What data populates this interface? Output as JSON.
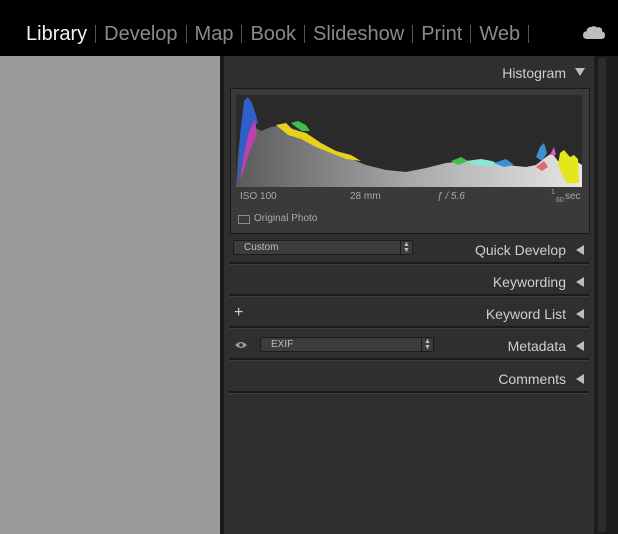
{
  "modules": [
    {
      "label": "Library",
      "active": true
    },
    {
      "label": "Develop",
      "active": false
    },
    {
      "label": "Map",
      "active": false
    },
    {
      "label": "Book",
      "active": false
    },
    {
      "label": "Slideshow",
      "active": false
    },
    {
      "label": "Print",
      "active": false
    },
    {
      "label": "Web",
      "active": false
    }
  ],
  "cloud_icon": "cloud-icon",
  "histogram": {
    "title": "Histogram",
    "iso": "ISO 100",
    "focal": "28 mm",
    "aperture": "ƒ / 5.6",
    "shutter_num": "1",
    "shutter_den": "60",
    "shutter_unit": "sec",
    "original_photo": "Original Photo"
  },
  "quick_develop": {
    "title": "Quick Develop",
    "preset": "Custom"
  },
  "keywording": {
    "title": "Keywording"
  },
  "keyword_list": {
    "title": "Keyword List",
    "add_icon": "plus-icon"
  },
  "metadata": {
    "title": "Metadata",
    "preset": "EXIF",
    "eye_icon": "eye-icon"
  },
  "comments": {
    "title": "Comments"
  },
  "colors": {
    "topbar": "#000000",
    "panel": "#2f2f2f",
    "viewer": "#9b9b9b",
    "active_text": "#f2f2f2",
    "inactive_text": "#8a8a8a"
  }
}
